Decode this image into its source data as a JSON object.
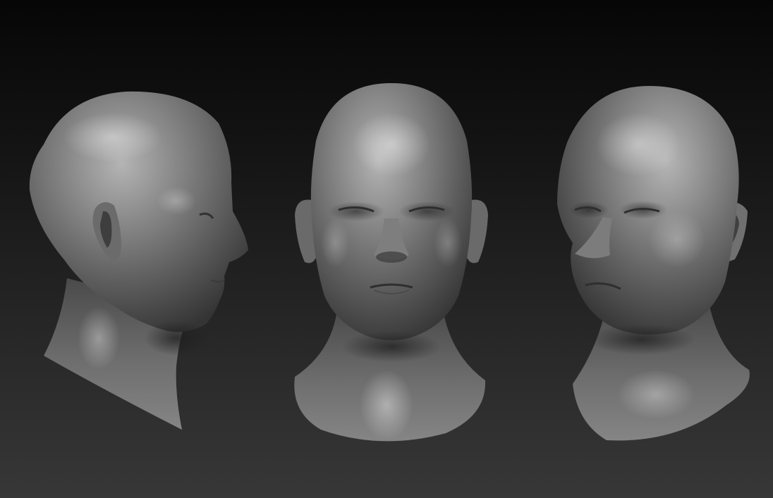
{
  "scene": {
    "background_top": "#060606",
    "background_bottom": "#373737",
    "material": "matcap-grey-clay",
    "views": [
      {
        "view": "profile-right"
      },
      {
        "view": "front"
      },
      {
        "view": "three-quarter-left"
      }
    ]
  }
}
